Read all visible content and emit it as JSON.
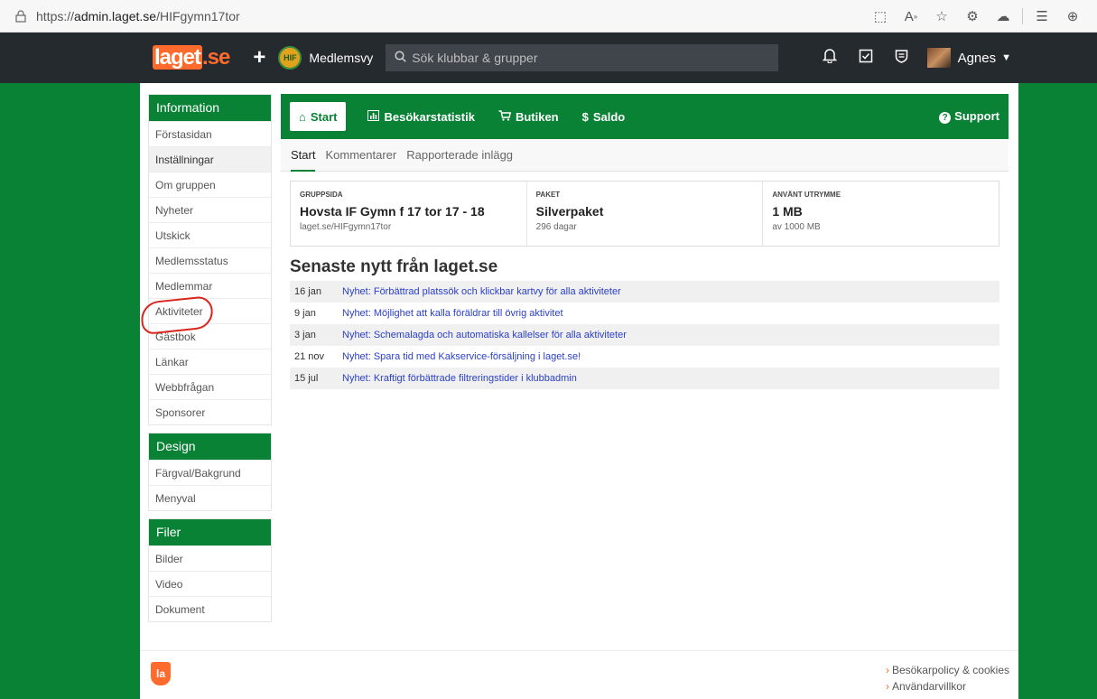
{
  "browser": {
    "url_prefix": "https://",
    "url_host": "admin.laget.se",
    "url_path": "/HIFgymn17tor"
  },
  "topnav": {
    "logo": "laget.se",
    "view_label": "Medlemsvy",
    "search_placeholder": "Sök klubbar & grupper",
    "user_name": "Agnes"
  },
  "sidebar": {
    "groups": [
      {
        "title": "Information",
        "items": [
          "Förstasidan",
          "Inställningar",
          "Om gruppen",
          "Nyheter",
          "Utskick",
          "Medlemsstatus",
          "Medlemmar",
          "Aktiviteter",
          "Gästbok",
          "Länkar",
          "Webbfrågan",
          "Sponsorer"
        ]
      },
      {
        "title": "Design",
        "items": [
          "Färgval/Bakgrund",
          "Menyval"
        ]
      },
      {
        "title": "Filer",
        "items": [
          "Bilder",
          "Video",
          "Dokument"
        ]
      }
    ]
  },
  "toolbar": {
    "start": "Start",
    "stats": "Besökarstatistik",
    "shop": "Butiken",
    "balance": "Saldo",
    "support": "Support"
  },
  "subtabs": [
    "Start",
    "Kommentarer",
    "Rapporterade inlägg"
  ],
  "info": [
    {
      "label": "GRUPPSIDA",
      "value": "Hovsta IF Gymn f 17 tor 17 - 18",
      "sub": "laget.se/HIFgymn17tor"
    },
    {
      "label": "PAKET",
      "value": "Silverpaket",
      "sub": "296 dagar"
    },
    {
      "label": "ANVÄNT UTRYMME",
      "value": "1 MB",
      "sub": "av 1000 MB"
    }
  ],
  "news": {
    "title": "Senaste nytt från laget.se",
    "items": [
      {
        "date": "16 jan",
        "text": "Nyhet: Förbättrad platssök och klickbar kartvy för alla aktiviteter"
      },
      {
        "date": "9 jan",
        "text": "Nyhet: Möjlighet att kalla föräldrar till övrig aktivitet"
      },
      {
        "date": "3 jan",
        "text": "Nyhet: Schemalagda och automatiska kallelser för alla aktiviteter"
      },
      {
        "date": "21 nov",
        "text": "Nyhet: Spara tid med Kakservice-försäljning i laget.se!"
      },
      {
        "date": "15 jul",
        "text": "Nyhet: Kraftigt förbättrade filtreringstider i klubbadmin"
      }
    ]
  },
  "footer": {
    "logo": "la",
    "link1": "Besökarpolicy & cookies",
    "link2": "Användarvillkor"
  }
}
